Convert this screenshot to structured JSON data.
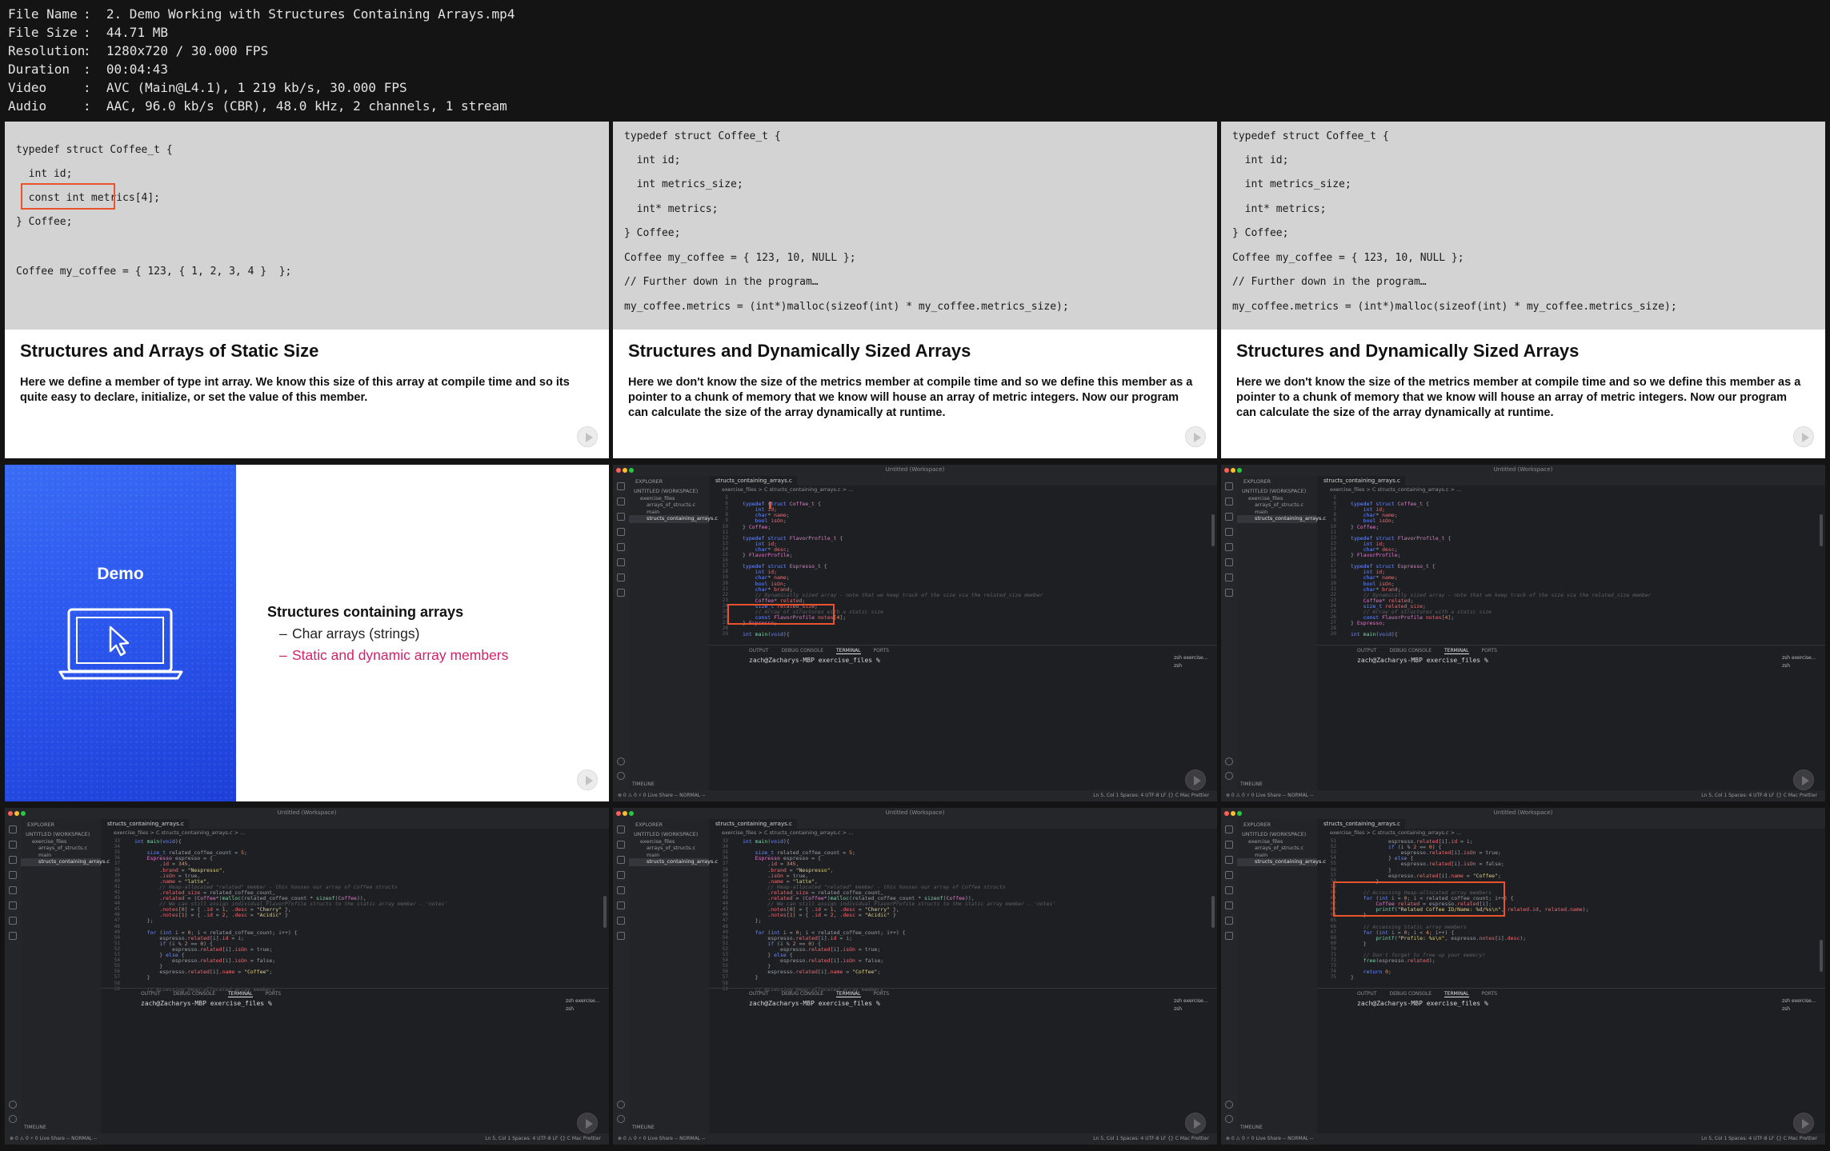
{
  "meta": [
    {
      "key": "File Name",
      "value": "2. Demo Working with Structures Containing Arrays.mp4"
    },
    {
      "key": "File Size",
      "value": "44.71 MB"
    },
    {
      "key": "Resolution",
      "value": "1280x720 / 30.000 FPS"
    },
    {
      "key": "Duration",
      "value": "00:04:43"
    },
    {
      "key": "Video",
      "value": "AVC (Main@L4.1), 1 219 kb/s, 30.000 FPS"
    },
    {
      "key": "Audio",
      "value": "AAC, 96.0 kb/s (CBR), 48.0 kHz, 2 channels, 1 stream"
    }
  ],
  "slide_static": {
    "code": [
      "typedef struct Coffee_t {",
      "  int id;",
      "  const int metrics[4];",
      "} Coffee;",
      "Coffee my_coffee = { 123, { 1, 2, 3, 4 }  };"
    ],
    "title": "Structures and Arrays of Static Size",
    "desc": "Here we define a member of type int array. We know this size of this array at compile time and so its quite easy to declare, initialize, or set the value of this member."
  },
  "slide_dynamic": {
    "code": [
      "typedef struct Coffee_t {",
      "  int id;",
      "  int metrics_size;",
      "  int* metrics;",
      "} Coffee;",
      "Coffee my_coffee = { 123, 10, NULL };",
      "// Further down in the program…",
      "my_coffee.metrics = (int*)malloc(sizeof(int) * my_coffee.metrics_size);"
    ],
    "title": "Structures and Dynamically Sized Arrays",
    "desc": "Here we don't know the size of the metrics member at compile time and so we define this member as a pointer to a chunk of memory that we know will house an array of metric integers. Now our program can calculate the size of the array dynamically at runtime."
  },
  "demo": {
    "title": "Demo",
    "heading": "Structures containing arrays",
    "items": [
      "Char arrays (strings)",
      "Static and dynamic array members"
    ]
  },
  "editor": {
    "window_title": "Untitled (Workspace)",
    "explorer": "EXPLORER",
    "workspace": "UNTITLED (WORKSPACE)",
    "folder": "exercise_files",
    "files": [
      "arrays_of_structs.c",
      "main",
      "structs_containing_arrays.c"
    ],
    "tab": "structs_containing_arrays.c",
    "breadcrumb": "exercise_files  >  C structs_containing_arrays.c  > ...",
    "panel_tabs": [
      "OUTPUT",
      "DEBUG CONSOLE",
      "TERMINAL",
      "PORTS"
    ],
    "terminal_prompt": "zach@Zacharys-MBP exercise_files % ",
    "term_list": [
      "zsh exercise...",
      "zsh"
    ],
    "timeline": "TIMELINE",
    "status_left": "⊗ 0  ⚠ 0  ⚡ 0   Live Share   -- NORMAL --",
    "status_right": "Ln 5, Col 1   Spaces: 4   UTF-8   LF   {} C   Mac   Prettier"
  },
  "code_a": [
    {
      "n": "5",
      "t": ""
    },
    {
      "n": "6",
      "t": "typedef struct Coffee_t {"
    },
    {
      "n": "7",
      "t": "    int id;"
    },
    {
      "n": "8",
      "t": "    char* name;"
    },
    {
      "n": "9",
      "t": "    bool isOn;"
    },
    {
      "n": "10",
      "t": "} Coffee;"
    },
    {
      "n": "11",
      "t": ""
    },
    {
      "n": "12",
      "t": "typedef struct FlavorProfile_t {"
    },
    {
      "n": "13",
      "t": "    int id;"
    },
    {
      "n": "14",
      "t": "    char* desc;"
    },
    {
      "n": "15",
      "t": "} FlavorProfile;"
    },
    {
      "n": "16",
      "t": ""
    },
    {
      "n": "17",
      "t": "typedef struct Espresso_t {"
    },
    {
      "n": "18",
      "t": "    int id;"
    },
    {
      "n": "19",
      "t": "    char* name;"
    },
    {
      "n": "20",
      "t": "    bool isOn;"
    },
    {
      "n": "21",
      "t": "    char* brand;"
    },
    {
      "n": "22",
      "t": "    // Dynamically sized array - note that we keep track of the size via the related_size member"
    },
    {
      "n": "23",
      "t": "    Coffee* related;"
    },
    {
      "n": "24",
      "t": "    size_t related_size;"
    },
    {
      "n": "25",
      "t": "    // Array of structures with a static size"
    },
    {
      "n": "26",
      "t": "    const FlavorProfile notes[4];"
    },
    {
      "n": "27",
      "t": "} Espresso;"
    },
    {
      "n": "28",
      "t": ""
    },
    {
      "n": "29",
      "t": "int main(void){"
    }
  ],
  "code_b": [
    {
      "n": "33",
      "t": "int main(void){"
    },
    {
      "n": "34",
      "t": ""
    },
    {
      "n": "35",
      "t": "    size_t related_coffee_count = 5;"
    },
    {
      "n": "36",
      "t": "    Espresso espresso = {"
    },
    {
      "n": "37",
      "t": "        .id = 345,"
    },
    {
      "n": "38",
      "t": "        .brand = \"Nespresso\","
    },
    {
      "n": "39",
      "t": "        .isOn = true,"
    },
    {
      "n": "40",
      "t": "        .name = \"latte\","
    },
    {
      "n": "41",
      "t": "        // Heap-allocated \"related\" member - this houses our array of Coffee structs"
    },
    {
      "n": "42",
      "t": "        .related_size = related_coffee_count,"
    },
    {
      "n": "43",
      "t": "        .related = (Coffee*)malloc(related_coffee_count * sizeof(Coffee)),"
    },
    {
      "n": "44",
      "t": "        // We can still assign individual FlavorProfile structs to the static array member - 'notes'"
    },
    {
      "n": "45",
      "t": "        .notes[0] = { .id = 1, .desc = \"Cherry\" },"
    },
    {
      "n": "46",
      "t": "        .notes[1] = { .id = 2, .desc = \"Acidic\" }"
    },
    {
      "n": "47",
      "t": "    };"
    },
    {
      "n": "48",
      "t": ""
    },
    {
      "n": "49",
      "t": "    for (int i = 0; i < related_coffee_count; i++) {"
    },
    {
      "n": "50",
      "t": "        espresso.related[i].id = i;"
    },
    {
      "n": "51",
      "t": "        if (i % 2 == 0) {"
    },
    {
      "n": "52",
      "t": "            espresso.related[i].isOn = true;"
    },
    {
      "n": "53",
      "t": "        } else {"
    },
    {
      "n": "54",
      "t": "            espresso.related[i].isOn = false;"
    },
    {
      "n": "55",
      "t": "        }"
    },
    {
      "n": "56",
      "t": "        espresso.related[i].name = \"Coffee\";"
    },
    {
      "n": "57",
      "t": "    }"
    },
    {
      "n": "58",
      "t": ""
    },
    {
      "n": "59",
      "t": "    // Accessing Heap-allocated array members"
    }
  ],
  "code_c": [
    {
      "n": "51",
      "t": "            espresso.related[i].id = i;"
    },
    {
      "n": "52",
      "t": "            if (i % 2 == 0) {"
    },
    {
      "n": "53",
      "t": "                espresso.related[i].isOn = true;"
    },
    {
      "n": "54",
      "t": "            } else {"
    },
    {
      "n": "55",
      "t": "                espresso.related[i].isOn = false;"
    },
    {
      "n": "56",
      "t": "            }"
    },
    {
      "n": "57",
      "t": "            espresso.related[i].name = \"Coffee\";"
    },
    {
      "n": "58",
      "t": "        }"
    },
    {
      "n": "59",
      "t": ""
    },
    {
      "n": "60",
      "t": "    // Accessing Heap-allocated array members"
    },
    {
      "n": "61",
      "t": "    for (int i = 0; i < related_coffee_count; i++) {"
    },
    {
      "n": "62",
      "t": "        Coffee related = espresso.related[i];"
    },
    {
      "n": "63",
      "t": "        printf(\"Related Coffee ID/Name: %d/%s\\n\", related.id, related.name);"
    },
    {
      "n": "64",
      "t": "    }"
    },
    {
      "n": "65",
      "t": ""
    },
    {
      "n": "66",
      "t": "    // Accessing Static array members"
    },
    {
      "n": "67",
      "t": "    for (int i = 0; i < 4; i++) {"
    },
    {
      "n": "68",
      "t": "        printf(\"Profile: %s\\n\", espresso.notes[i].desc);"
    },
    {
      "n": "69",
      "t": "    }"
    },
    {
      "n": "70",
      "t": ""
    },
    {
      "n": "71",
      "t": "    // Don't forget to free up your memory!"
    },
    {
      "n": "72",
      "t": "    free(espresso.related);"
    },
    {
      "n": "73",
      "t": ""
    },
    {
      "n": "74",
      "t": "    return 0;"
    },
    {
      "n": "75",
      "t": "}"
    }
  ],
  "colors": {
    "accent_red": "#e8532c",
    "demo_blue": "#2b57ee",
    "demo_pink": "#d3226d"
  }
}
